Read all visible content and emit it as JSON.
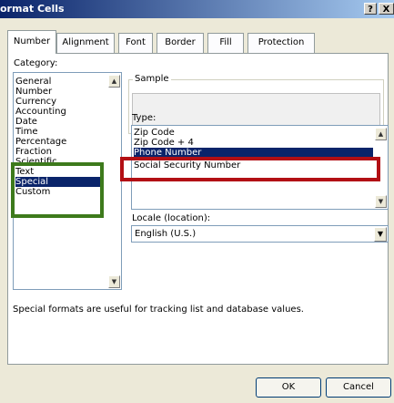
{
  "window": {
    "title": "ormat Cells",
    "help_label": "?",
    "close_label": "X"
  },
  "tabs": [
    {
      "label": "Number",
      "active": true
    },
    {
      "label": "Alignment"
    },
    {
      "label": "Font"
    },
    {
      "label": "Border"
    },
    {
      "label": "Fill"
    },
    {
      "label": "Protection"
    }
  ],
  "category": {
    "label": "Category:",
    "items": [
      "General",
      "Number",
      "Currency",
      "Accounting",
      "Date",
      "Time",
      "Percentage",
      "Fraction",
      "Scientific",
      "Text",
      "Special",
      "Custom"
    ],
    "selected": "Special"
  },
  "sample": {
    "label": "Sample"
  },
  "type": {
    "label": "Type:",
    "items": [
      "Zip Code",
      "Zip Code + 4",
      "Phone Number",
      "Social Security Number"
    ],
    "selected": "Phone Number"
  },
  "locale": {
    "label": "Locale (location):",
    "value": "English (U.S.)"
  },
  "description": "Special formats are useful for tracking list and database values.",
  "buttons": {
    "ok": "OK",
    "cancel": "Cancel"
  },
  "colors": {
    "highlight_green": "#3d7a1c",
    "highlight_red": "#b20f14",
    "selection": "#0a246a"
  }
}
